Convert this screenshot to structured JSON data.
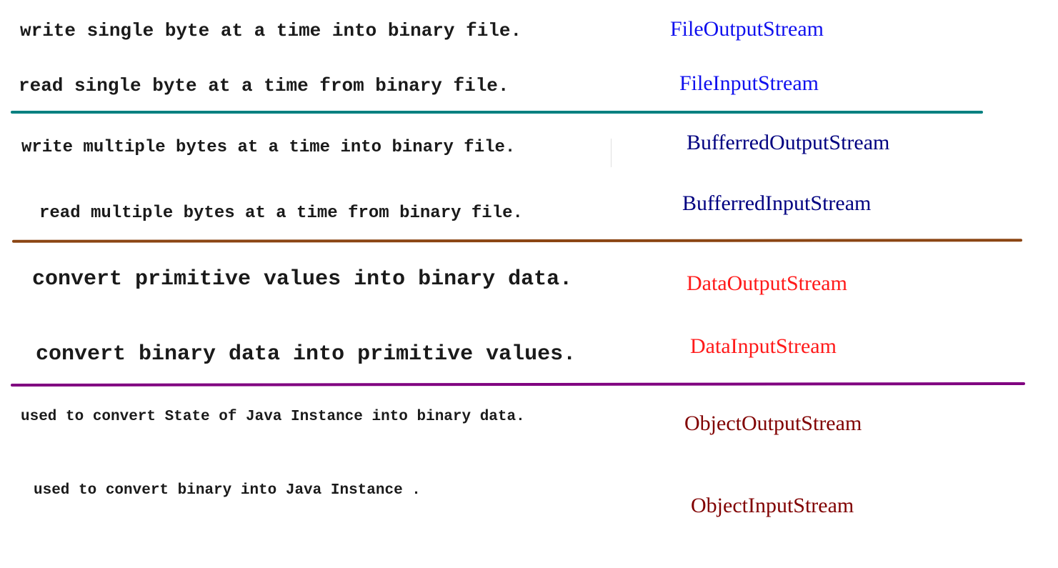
{
  "sections": [
    {
      "rows": [
        {
          "desc": "write single byte at a time into binary file.",
          "cls": "FileOutputStream"
        },
        {
          "desc": "read single byte at a time from binary file.",
          "cls": "FileInputStream"
        }
      ],
      "color": "#1010ee",
      "rule_color": "#008080"
    },
    {
      "rows": [
        {
          "desc": "write multiple bytes at a time into binary file.",
          "cls": "BufferredOutputStream"
        },
        {
          "desc": "read multiple bytes at a time from binary file.",
          "cls": "BufferredInputStream"
        }
      ],
      "color": "#000080",
      "rule_color": "#8b4513"
    },
    {
      "rows": [
        {
          "desc": "convert primitive values into binary data.",
          "cls": "DataOutputStream"
        },
        {
          "desc": "convert binary data into primitive values.",
          "cls": "DataInputStream"
        }
      ],
      "color": "#ff1a1a",
      "rule_color": "#800080"
    },
    {
      "rows": [
        {
          "desc": "used to convert State of Java Instance into binary data.",
          "cls": "ObjectOutputStream"
        },
        {
          "desc": "used to convert binary into Java Instance .",
          "cls": "ObjectInputStream"
        }
      ],
      "color": "#800000"
    }
  ]
}
